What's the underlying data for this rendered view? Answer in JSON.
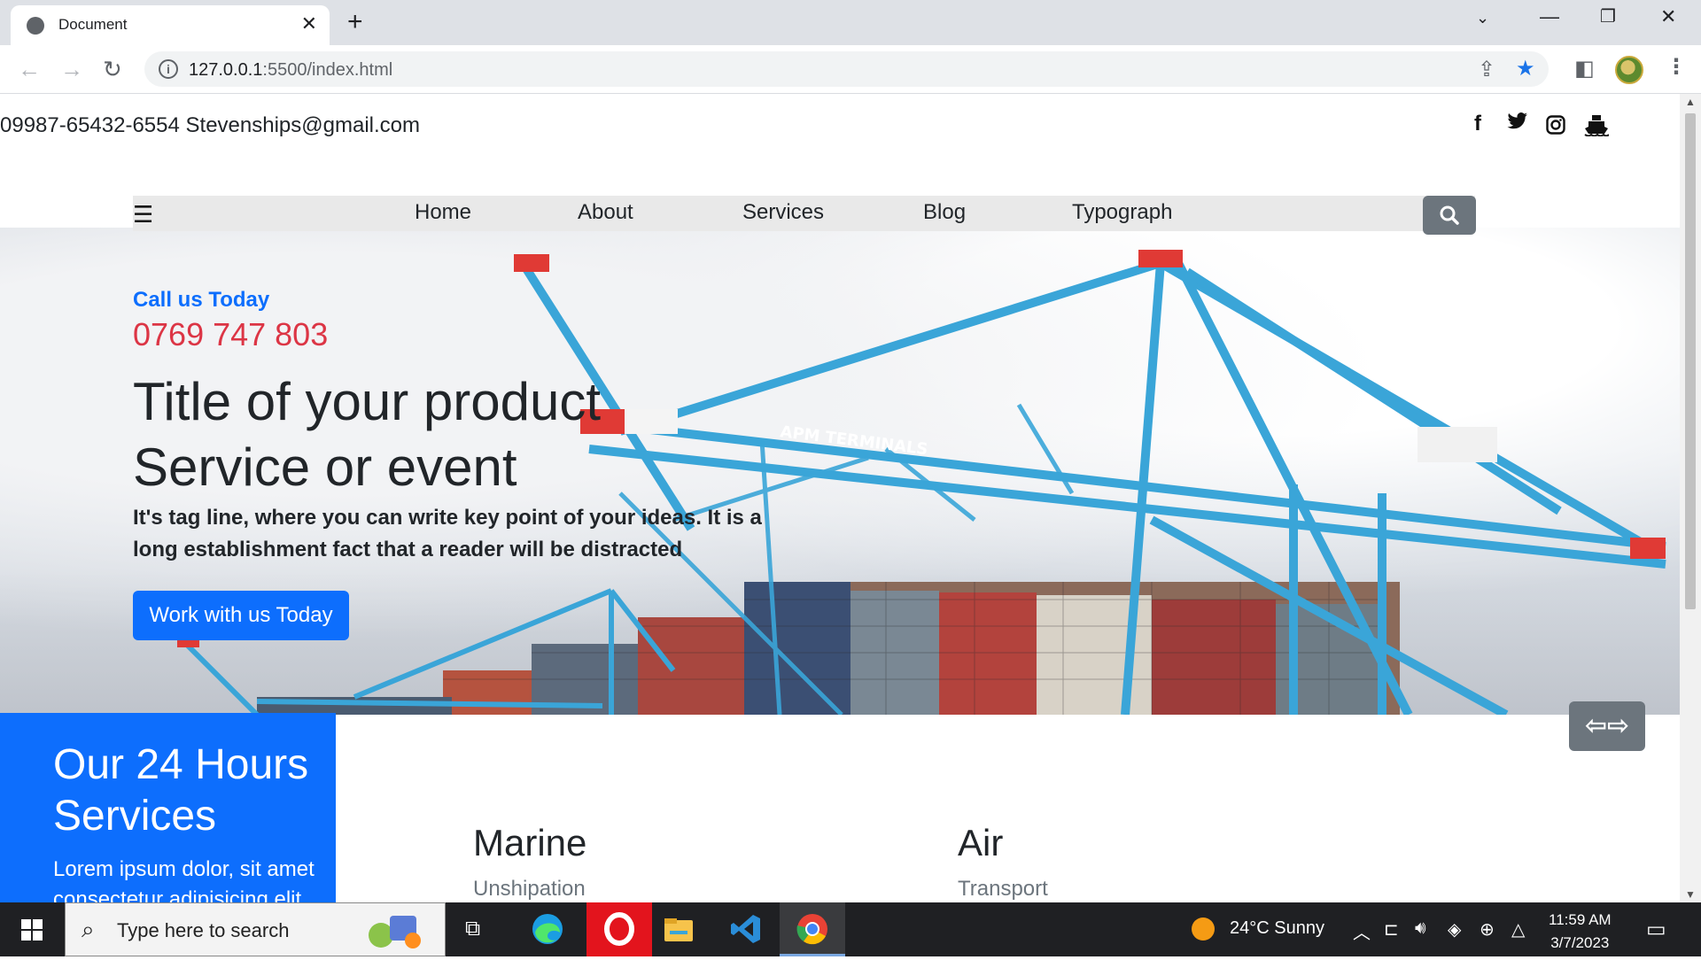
{
  "browser": {
    "tab_title": "Document",
    "url_host": "127.0.0.1",
    "url_rest": ":5500/index.html"
  },
  "topbar": {
    "contact": "09987-65432-6554 Stevenships@gmail.com",
    "social_icons": [
      "facebook-icon",
      "twitter-icon",
      "instagram-icon",
      "ship-icon"
    ]
  },
  "nav": {
    "items": [
      {
        "label": "Home"
      },
      {
        "label": "About"
      },
      {
        "label": "Services"
      },
      {
        "label": "Blog"
      },
      {
        "label": "Typograph"
      }
    ]
  },
  "hero": {
    "call_label": "Call us Today",
    "phone": "0769 747 803",
    "title_line1": "Title of your product",
    "title_line2": "Service or event",
    "tagline": "It's tag line, where you can write key point of your ideas. It is a long establishment fact that a reader will be distracted",
    "cta_label": "Work with us Today"
  },
  "services": {
    "title": "Our 24 Hours Services",
    "text": "Lorem ipsum dolor, sit amet consectetur adipisicing elit",
    "items": [
      {
        "title": "Marine",
        "subtitle": "Unshipation"
      },
      {
        "title": "Air",
        "subtitle": "Transport"
      }
    ]
  },
  "taskbar": {
    "search_placeholder": "Type here to search",
    "weather": "24°C  Sunny",
    "time": "11:59 AM",
    "date": "3/7/2023"
  },
  "colors": {
    "primary": "#0d6efd",
    "danger": "#dc3545",
    "secondary": "#6c757d",
    "crane_blue": "#3aa5d8"
  }
}
